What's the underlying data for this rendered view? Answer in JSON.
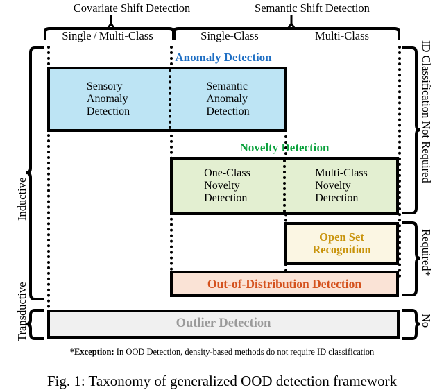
{
  "figure": {
    "top_groups": [
      {
        "label": "Covariate Shift Detection"
      },
      {
        "label": "Semantic Shift Detection"
      }
    ],
    "columns": [
      {
        "label": "Single / Multi-Class"
      },
      {
        "label": "Single-Class"
      },
      {
        "label": "Multi-Class"
      }
    ],
    "group_titles": {
      "anomaly": "Anomaly Detection",
      "novelty": "Novelty Detection"
    },
    "boxes": {
      "sensory_anomaly": "Sensory\nAnomaly\nDetection",
      "sensory_anomaly_lines": [
        "Sensory",
        "Anomaly",
        "Detection"
      ],
      "semantic_anomaly_lines": [
        "Semantic",
        "Anomaly",
        "Detection"
      ],
      "one_class_novelty_lines": [
        "One-Class",
        "Novelty",
        "Detection"
      ],
      "multi_class_novelty_lines": [
        "Multi-Class",
        "Novelty",
        "Detection"
      ],
      "open_set_recognition_lines": [
        "Open Set",
        "Recognition"
      ],
      "ood_detection": "Out-of-Distribution Detection",
      "outlier_detection": "Outlier Detection"
    },
    "left_labels": [
      {
        "label": "Inductive"
      },
      {
        "label": "Transductive"
      }
    ],
    "right_labels": [
      {
        "label": "ID Classification Not Required"
      },
      {
        "label": "Required*"
      },
      {
        "label": "No"
      }
    ],
    "footnote": {
      "marker": "*Exception:",
      "text": " In OOD Detection, density-based methods do not require ID classification"
    },
    "caption": "Fig. 1: Taxonomy of generalized OOD detection framework",
    "colors": {
      "anomaly_title": "#1f6fc4",
      "novelty_title": "#0aa13c",
      "open_set": "#c8930b",
      "ood": "#d4521e",
      "outlier": "#9a9a9a",
      "blue_fill": "#bde4f4",
      "green_fill": "#e3efd1",
      "cream_fill": "#fbf6e3",
      "peach_fill": "#fae3d6",
      "grey_fill": "#f0f0f0"
    }
  }
}
